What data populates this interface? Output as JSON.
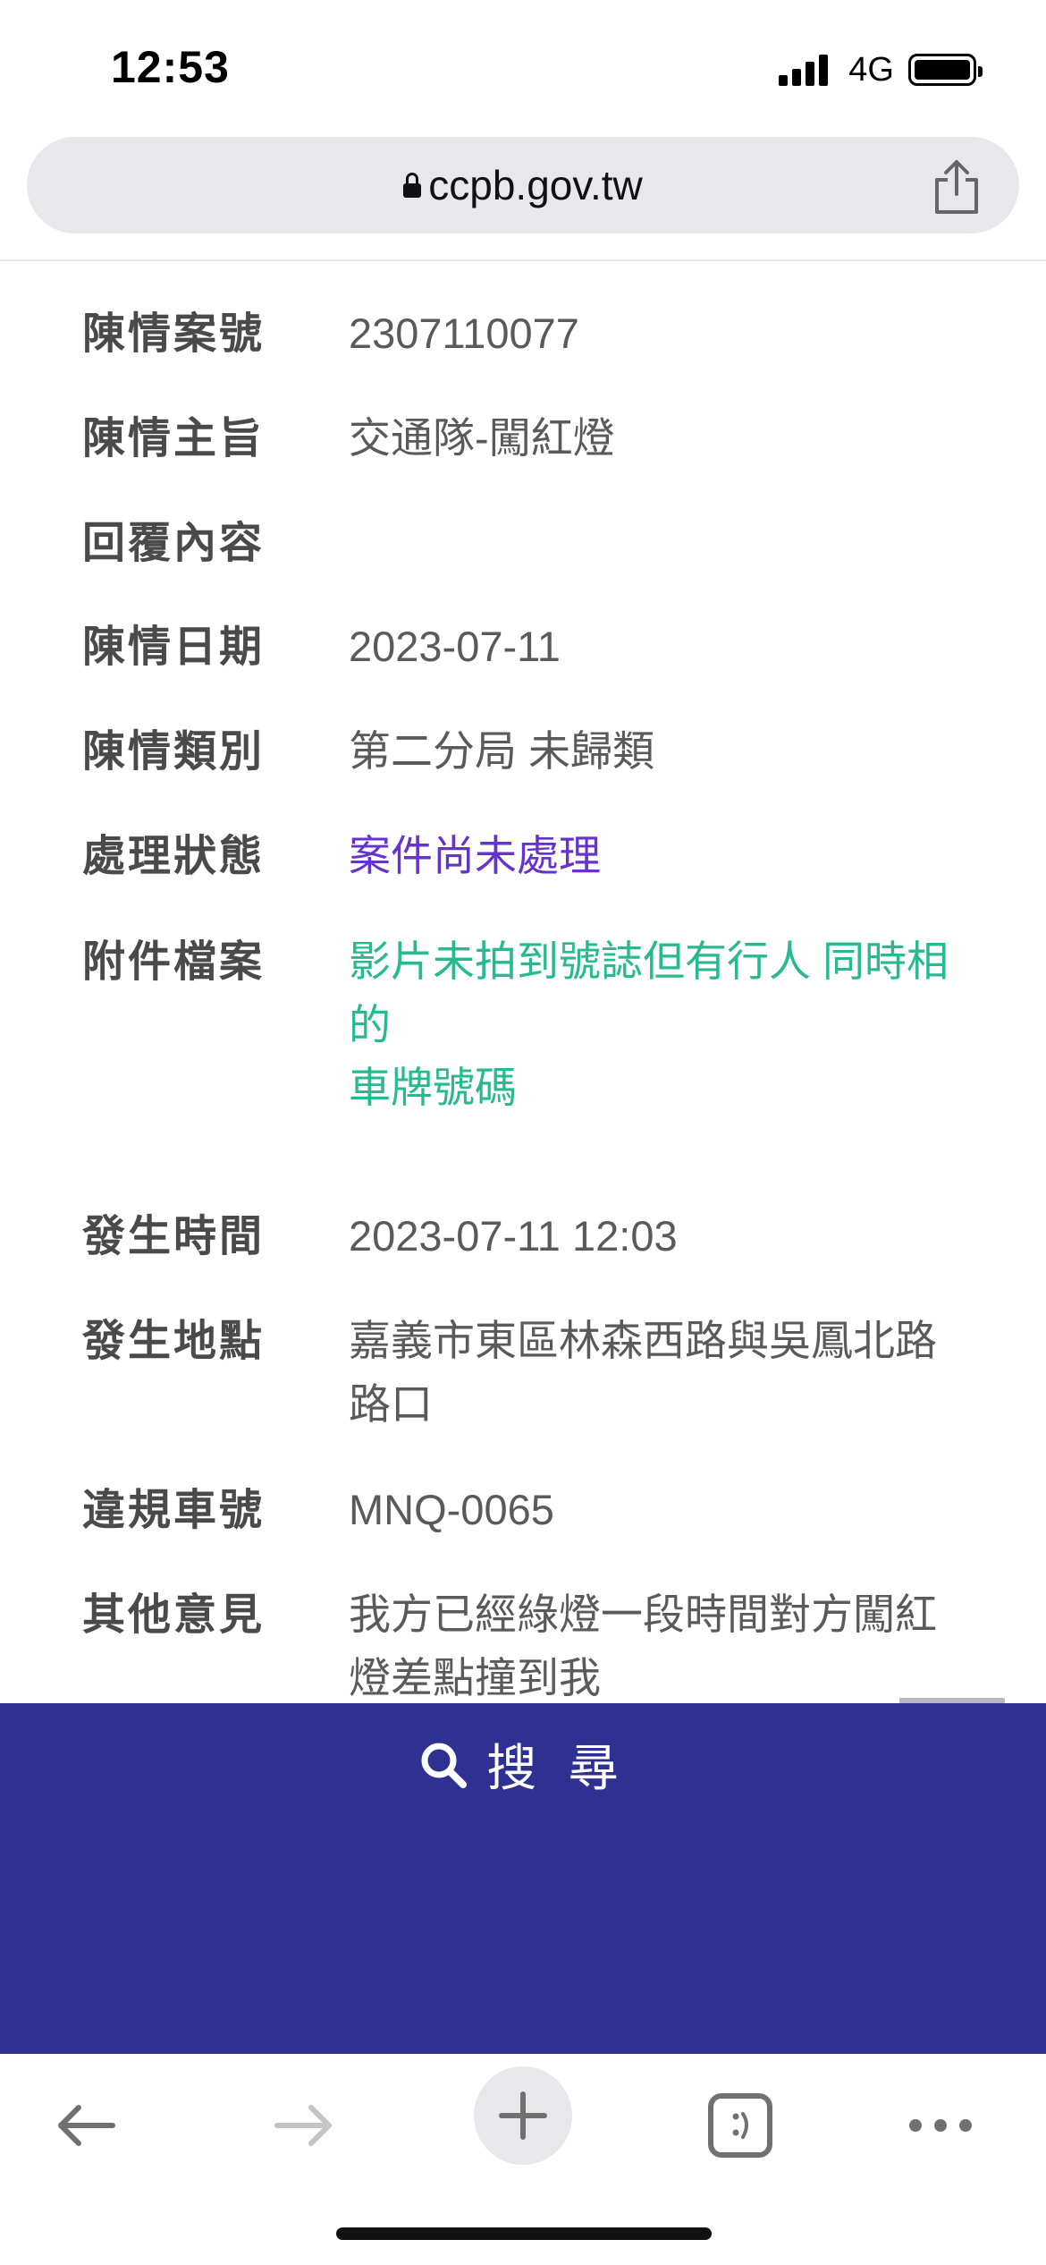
{
  "status_bar": {
    "time": "12:53",
    "network": "4G",
    "signal_bars": 4,
    "battery_level": 0.9
  },
  "browser": {
    "url": "ccpb.gov.tw",
    "lock_icon": "lock-icon",
    "share_icon": "share-icon"
  },
  "details": {
    "case_number": {
      "label": "陳情案號",
      "value": "2307110077"
    },
    "subject": {
      "label": "陳情主旨",
      "value": "交通隊-闖紅燈"
    },
    "reply": {
      "label": "回覆內容",
      "value": ""
    },
    "date": {
      "label": "陳情日期",
      "value": "2023-07-11"
    },
    "category": {
      "label": "陳情類別",
      "value": "第二分局 未歸類"
    },
    "status": {
      "label": "處理狀態",
      "value": "案件尚未處理"
    },
    "attachment": {
      "label": "附件檔案",
      "line1": "影片未拍到號誌但有行人 同時相",
      "line2": "的",
      "line3": "車牌號碼"
    },
    "occurred_time": {
      "label": "發生時間",
      "value": "2023-07-11 12:03"
    },
    "location": {
      "label": "發生地點",
      "line1": "嘉義市東區林森西路與吳鳳北路",
      "line2": "路口"
    },
    "plate": {
      "label": "違規車號",
      "value": "MNQ-0065"
    },
    "comment": {
      "label": "其他意見",
      "line1": "我方已經綠燈一段時間對方闖紅",
      "line2": "燈差點撞到我"
    }
  },
  "search": {
    "label": "搜 尋",
    "icon": "search-icon"
  },
  "colors": {
    "footer_bg": "#2e3192",
    "status_purple": "#6633cc",
    "attachment_teal": "#27b98f"
  },
  "toolbar": {
    "icons": [
      "back-arrow-icon",
      "forward-arrow-icon",
      "new-tab-plus-icon",
      "tabs-icon",
      "more-dots-icon"
    ]
  }
}
